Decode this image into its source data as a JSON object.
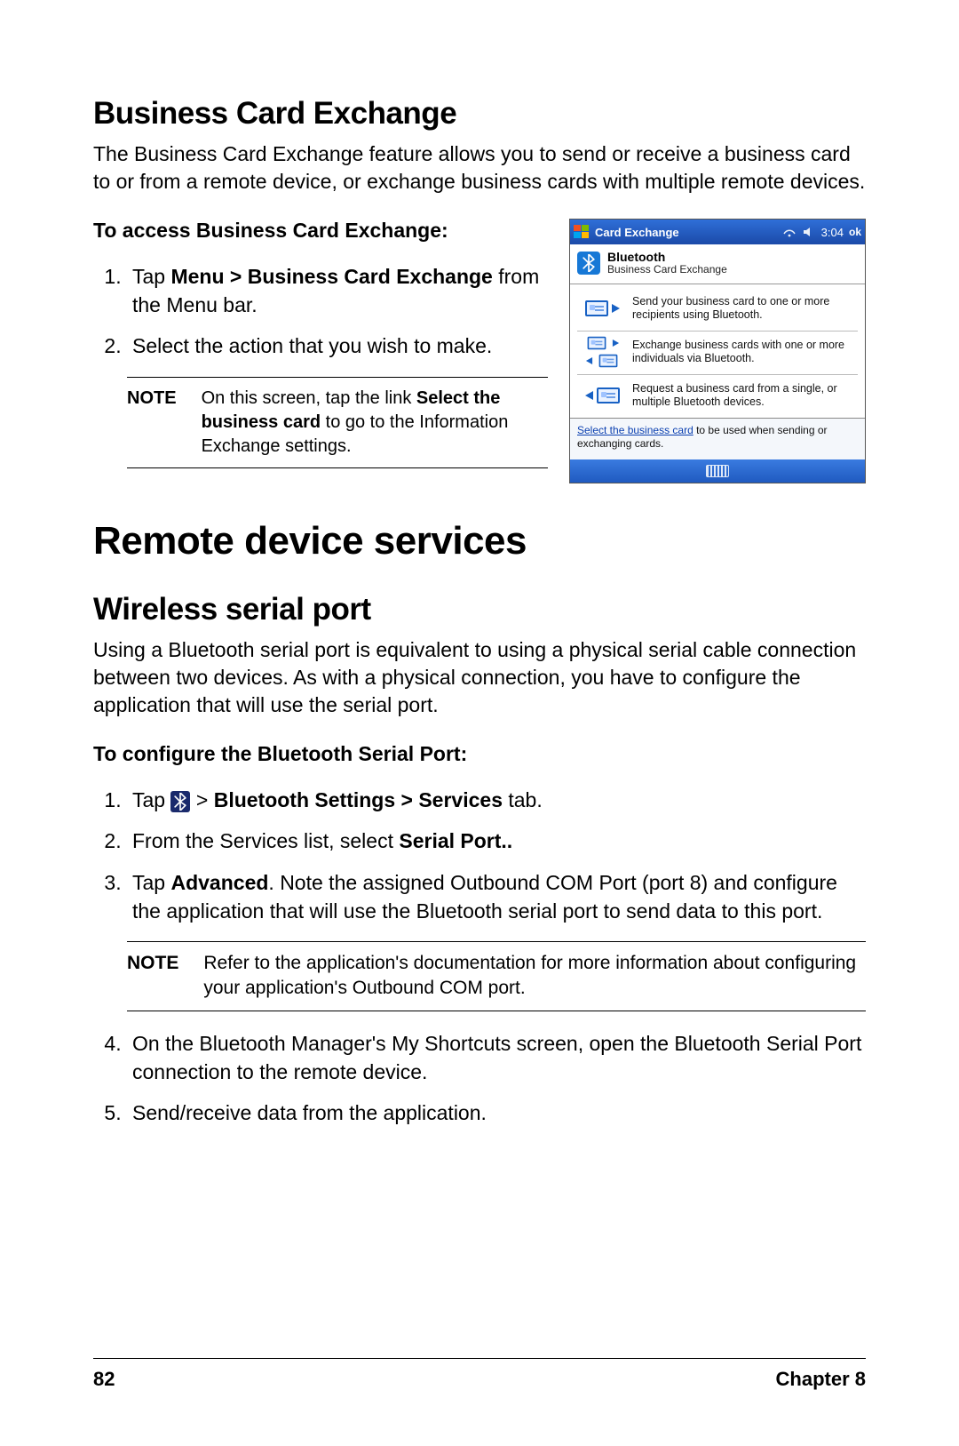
{
  "sec1": {
    "heading": "Business Card Exchange",
    "intro": "The Business Card Exchange feature allows you to send or receive a business card to or from a remote device, or exchange business cards with multiple remote devices.",
    "sub": "To access Business Card Exchange:",
    "step1_a": "Tap ",
    "step1_b": "Menu > Business Card Exchange",
    "step1_c": " from the Menu bar.",
    "step2": "Select the action that you wish to make.",
    "note_label": "NOTE",
    "note_a": "On this screen, tap the link ",
    "note_b": "Select the business card",
    "note_c": " to go to the Information Exchange settings."
  },
  "device": {
    "titlebar": {
      "title": "Card Exchange",
      "time": "3:04",
      "ok": "ok"
    },
    "header_title": "Bluetooth",
    "header_sub": "Business Card Exchange",
    "items": [
      "Send your business card to one or more recipients using Bluetooth.",
      "Exchange business cards with one or more individuals via Bluetooth.",
      "Request a business card from a single, or multiple Bluetooth devices."
    ],
    "footer_link": "Select the business card",
    "footer_rest": " to be used when sending or exchanging cards."
  },
  "sec2": {
    "big": "Remote device services",
    "heading": "Wireless serial port",
    "intro": "Using a Bluetooth serial port is equivalent to using a physical serial cable connection between two devices. As with a physical connection, you have to configure the application that will use the serial port.",
    "sub": "To configure the Bluetooth Serial Port:",
    "s1_a": "Tap ",
    "s1_b": " > ",
    "s1_c": "Bluetooth Settings > Services",
    "s1_d": " tab.",
    "s2_a": "From the Services list, select ",
    "s2_b": "Serial Port..",
    "s3_a": "Tap ",
    "s3_b": "Advanced",
    "s3_c": ". Note the assigned Outbound COM Port  (port 8) and configure the application that will use the Bluetooth serial port to send data to this port.",
    "note_label": "NOTE",
    "note_body": "Refer to the application's documentation for more information about configuring your application's Outbound COM port.",
    "s4": "On the Bluetooth Manager's My Shortcuts screen, open the Bluetooth Serial Port connection to the remote device.",
    "s5": "Send/receive data from the application."
  },
  "footer": {
    "page": "82",
    "chapter": "Chapter 8"
  }
}
